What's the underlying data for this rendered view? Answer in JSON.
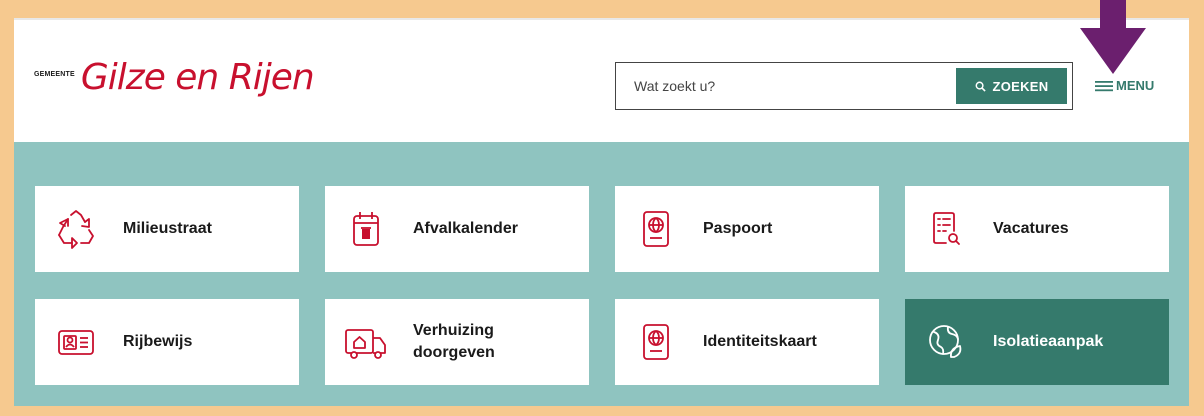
{
  "logo": {
    "small": "GEMEENTE",
    "main": "Gilze en Rijen"
  },
  "search": {
    "placeholder": "Wat zoekt u?",
    "button_label": "ZOEKEN"
  },
  "menu": {
    "label": "MENU"
  },
  "tiles": [
    {
      "label": "Milieustraat",
      "icon": "recycle-icon"
    },
    {
      "label": "Afvalkalender",
      "icon": "calendar-bin-icon"
    },
    {
      "label": "Paspoort",
      "icon": "passport-icon"
    },
    {
      "label": "Vacatures",
      "icon": "document-search-icon"
    },
    {
      "label": "Rijbewijs",
      "icon": "id-card-icon"
    },
    {
      "label": "Verhuizing doorgeven",
      "icon": "moving-truck-icon"
    },
    {
      "label": "Identiteitskaart",
      "icon": "passport-icon"
    },
    {
      "label": "Isolatieaanpak",
      "icon": "globe-leaf-icon"
    }
  ],
  "colors": {
    "brand_red": "#c8102e",
    "accent_green": "#357a6c",
    "panel_teal": "#8fc4c0",
    "annotation_purple": "#6b1f6e",
    "border_orange": "#f6c98f"
  }
}
